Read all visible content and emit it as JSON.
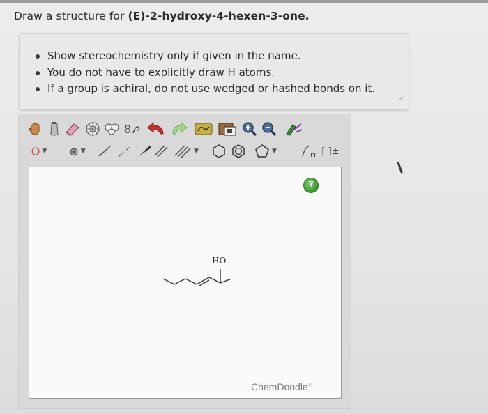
{
  "question": {
    "prefix": "Draw a structure for ",
    "compound": "(E)-2-hydroxy-4-hexen-3-one."
  },
  "hints": [
    "Show stereochemistry only if given in the name.",
    "You do not have to explicitly draw H atoms.",
    "If a group is achiral, do not use wedged or hashed bonds on it."
  ],
  "toolbar_row1": [
    "hand-icon",
    "eraser-bottle-icon",
    "eraser-icon",
    "ring-template-icon",
    "copy-icon",
    "cut-icon",
    "undo-icon",
    "redo-icon",
    "lasso-icon",
    "save-icon",
    "zoom-in-icon",
    "zoom-out-icon",
    "clean-icon"
  ],
  "toolbar_row2": {
    "atom_label": "O",
    "charge_label": "⊕",
    "repeat_label": "n",
    "bracket_label": "[ ]±"
  },
  "canvas": {
    "help_label": "?",
    "atom_label": "HO",
    "brand": "ChemDoodle",
    "brand_mark": "®"
  },
  "colors": {
    "help_green": "#3b9a2e",
    "undo_red": "#c0302a",
    "redo_green": "#5aa83c",
    "zoom_blue": "#2d4f7c"
  }
}
